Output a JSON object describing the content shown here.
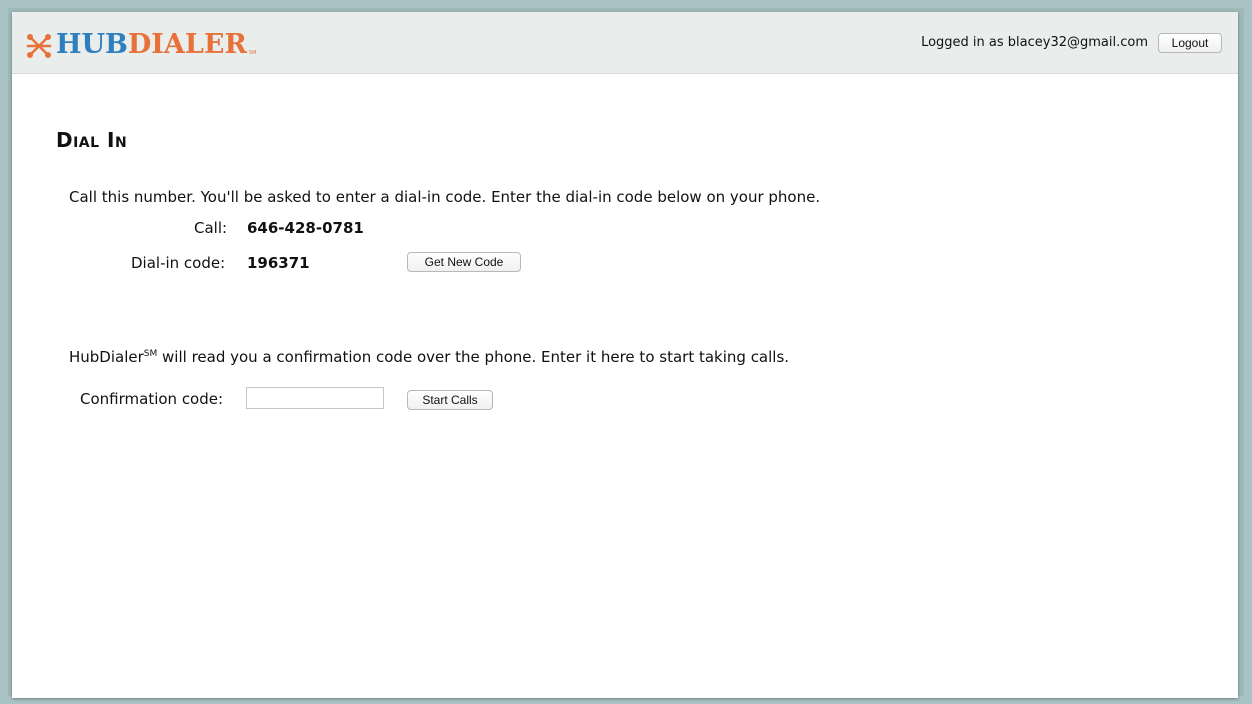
{
  "header": {
    "logo": {
      "hub": "HUB",
      "dialer": "DIALER",
      "sm": "SM"
    },
    "user_text": "Logged in as blacey32@gmail.com",
    "logout_label": "Logout"
  },
  "page": {
    "title": "Dial In",
    "instructions": "Call this number. You'll be asked to enter a dial-in code. Enter the dial-in code below on your phone.",
    "call_label": "Call:",
    "call_number": "646-428-0781",
    "dial_in_label": "Dial-in code:",
    "dial_in_code": "196371",
    "get_new_code_label": "Get New Code",
    "confirm_brand": "HubDialer",
    "confirm_brand_sup": "SM",
    "confirm_text": " will read you a confirmation code over the phone. Enter it here to start taking calls.",
    "confirmation_label": "Confirmation code:",
    "confirmation_value": "",
    "start_calls_label": "Start Calls"
  },
  "colors": {
    "brand_blue": "#2f7fbf",
    "brand_orange": "#e8713a",
    "header_bg": "#e9eeed",
    "page_bg": "#a9c2c4"
  }
}
